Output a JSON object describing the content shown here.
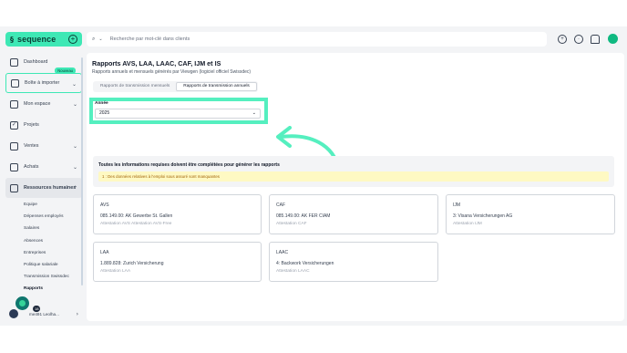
{
  "brand": {
    "name": "sequence",
    "mark": "§"
  },
  "search": {
    "placeholder": "Recherche par mot-clé dans clients"
  },
  "sidebar": {
    "items": [
      {
        "label": "Dashboard",
        "icon": "home-icon"
      },
      {
        "label": "Boîte à importer",
        "icon": "inbox-icon",
        "badge": "Nouveau"
      },
      {
        "label": "Mon espace",
        "icon": "person-icon"
      },
      {
        "label": "Projets",
        "icon": "check-icon"
      },
      {
        "label": "Ventes",
        "icon": "lock-icon"
      },
      {
        "label": "Achats",
        "icon": "bag-icon"
      },
      {
        "label": "Ressources humaines",
        "icon": "people-icon"
      }
    ],
    "sub_items": [
      "Equipe",
      "Dépenses employés",
      "Salaires",
      "Absences",
      "Entreprises",
      "Politique salariale",
      "Transmission Swissdec",
      "Rapports"
    ],
    "user_label": "me491 Leolha...",
    "user_count": "18"
  },
  "page": {
    "title": "Rapports AVS, LAA, LAAC, CAF, IJM et IS",
    "subtitle": "Rapports annuels et mensuels générés par Viewgen (logiciel officiel Swissdec)",
    "tabs": [
      "Rapports de transmission mensuels",
      "Rapports de transmission annuels"
    ],
    "year_label": "Année",
    "year_value": "2025",
    "info_title": "Toutes les informations requises doivent être complétées pour générer les rapports",
    "warning": "1 : Des données relatives à l'emploi sous assuré sont manquantes",
    "cards": [
      {
        "title": "AVS",
        "value": "085.149.00: AK Gewerbe St. Gallen",
        "attest": "Attestation AVS    Attestation AVS-Free"
      },
      {
        "title": "CAF",
        "value": "085.149.00: AK FER CIAM",
        "attest": "Attestation CAF"
      },
      {
        "title": "IJM",
        "value": "3: Visana Versicherungen AG",
        "attest": "Attestation IJM"
      },
      {
        "title": "LAA",
        "value": "1.889.828: Zurich Versicherung",
        "attest": "Attestation LAA"
      },
      {
        "title": "LAAC",
        "value": "4: Backwork Versicherungen",
        "attest": "Attestation LAAC"
      }
    ]
  },
  "colors": {
    "accent": "#3ee8b5",
    "highlight": "#55efbf"
  }
}
